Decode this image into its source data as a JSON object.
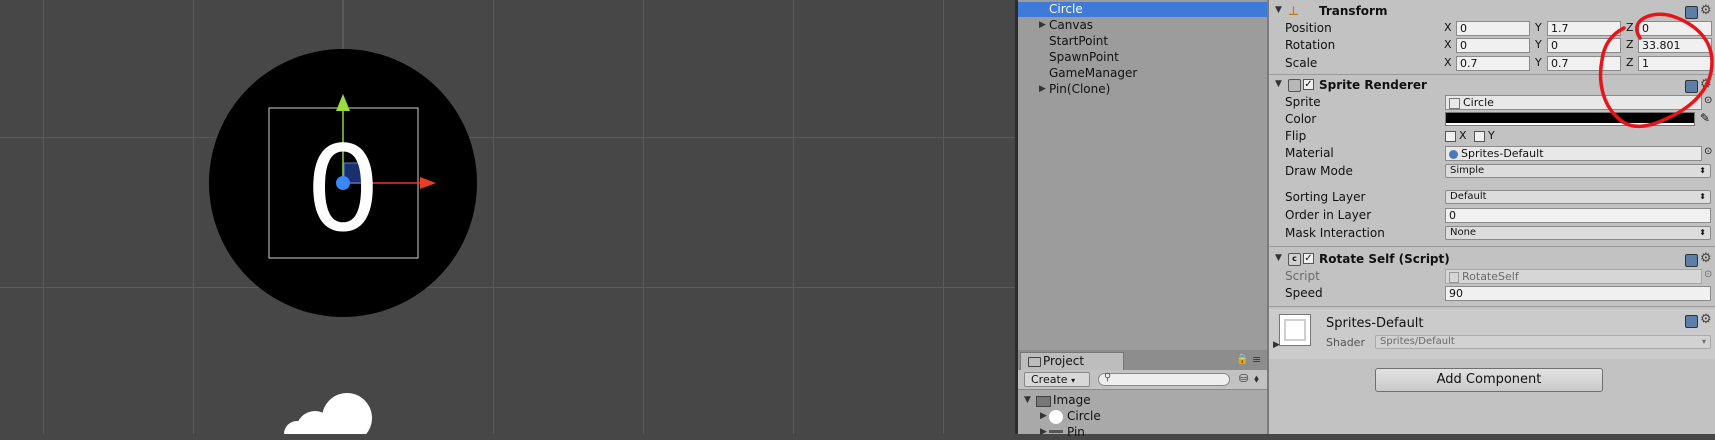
{
  "hierarchy": {
    "items": [
      {
        "label": "Circle",
        "selected": true,
        "expandable": false
      },
      {
        "label": "Canvas",
        "selected": false,
        "expandable": true
      },
      {
        "label": "StartPoint",
        "selected": false,
        "expandable": false
      },
      {
        "label": "SpawnPoint",
        "selected": false,
        "expandable": false
      },
      {
        "label": "GameManager",
        "selected": false,
        "expandable": false
      },
      {
        "label": "Pin(Clone)",
        "selected": false,
        "expandable": true
      }
    ]
  },
  "scene": {
    "digit": "0"
  },
  "project": {
    "tab_label": "Project",
    "create_label": "Create",
    "tree": [
      {
        "label": "Image"
      },
      {
        "label": "Circle"
      },
      {
        "label": "Pin"
      }
    ]
  },
  "inspector": {
    "transform": {
      "title": "Transform",
      "position_label": "Position",
      "rotation_label": "Rotation",
      "scale_label": "Scale",
      "position": {
        "x": "0",
        "y": "1.7",
        "z": "0"
      },
      "rotation": {
        "x": "0",
        "y": "0",
        "z": "33.801"
      },
      "scale": {
        "x": "0.7",
        "y": "0.7",
        "z": "1"
      },
      "axis_x": "X",
      "axis_y": "Y",
      "axis_z": "Z"
    },
    "sprite_renderer": {
      "title": "Sprite Renderer",
      "sprite_label": "Sprite",
      "sprite_value": "Circle",
      "color_label": "Color",
      "color_value": "#000000",
      "flip_label": "Flip",
      "flip_x": "X",
      "flip_y": "Y",
      "material_label": "Material",
      "material_value": "Sprites-Default",
      "draw_mode_label": "Draw Mode",
      "draw_mode_value": "Simple",
      "sorting_layer_label": "Sorting Layer",
      "sorting_layer_value": "Default",
      "order_label": "Order in Layer",
      "order_value": "0",
      "mask_label": "Mask Interaction",
      "mask_value": "None"
    },
    "rotate_self": {
      "title": "Rotate Self (Script)",
      "script_label": "Script",
      "script_value": "RotateSelf",
      "speed_label": "Speed",
      "speed_value": "90"
    },
    "material": {
      "name": "Sprites-Default",
      "shader_label": "Shader",
      "shader_value": "Sprites/Default"
    },
    "add_component_label": "Add Component"
  },
  "colors": {
    "selection": "#3e7ad8",
    "annotation": "#e8141a"
  }
}
